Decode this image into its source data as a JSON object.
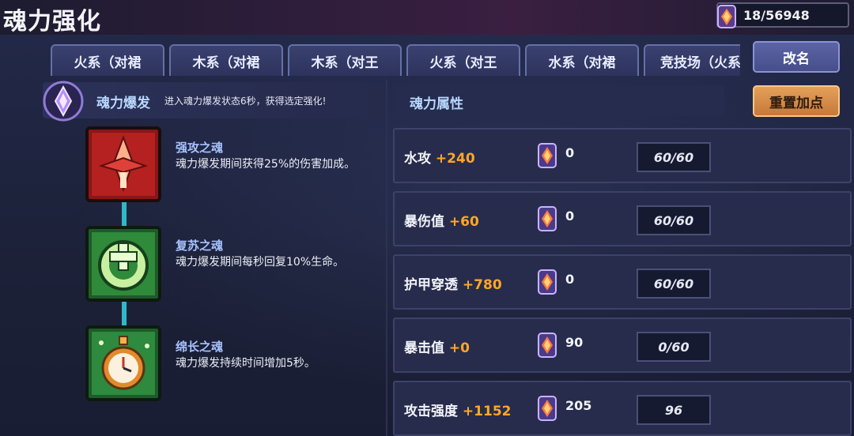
{
  "header": {
    "title": "魂力强化",
    "currency_value": "18/56948"
  },
  "tabs": [
    {
      "label": "火系（对裙"
    },
    {
      "label": "木系（对裙"
    },
    {
      "label": "木系（对王"
    },
    {
      "label": "火系（对王"
    },
    {
      "label": "水系（对裙"
    },
    {
      "label": "竞技场（火系"
    }
  ],
  "buttons": {
    "rename": "改名",
    "reset": "重置加点"
  },
  "soul_burst": {
    "title": "魂力爆发",
    "description": "进入魂力爆发状态6秒，获得选定强化!"
  },
  "buffs": [
    {
      "name": "强攻之魂",
      "description": "魂力爆发期间获得25%的伤害加成。",
      "icon": "red-sword-soul-icon"
    },
    {
      "name": "复苏之魂",
      "description": "魂力爆发期间每秒回复10%生命。",
      "icon": "green-heal-soul-icon"
    },
    {
      "name": "绵长之魂",
      "description": "魂力爆发持续时间增加5秒。",
      "icon": "stopwatch-soul-icon"
    }
  ],
  "attributes": {
    "title": "魂力属性",
    "rows": [
      {
        "name": "水攻",
        "bonus": "+240",
        "cost": "0",
        "level": "60/60"
      },
      {
        "name": "暴伤值",
        "bonus": "+60",
        "cost": "0",
        "level": "60/60"
      },
      {
        "name": "护甲穿透",
        "bonus": "+780",
        "cost": "0",
        "level": "60/60"
      },
      {
        "name": "暴击值",
        "bonus": "+0",
        "cost": "90",
        "level": "0/60"
      },
      {
        "name": "攻击强度",
        "bonus": "+1152",
        "cost": "205",
        "level": "96"
      }
    ]
  },
  "colors": {
    "accent_orange": "#ffa726",
    "label_blue": "#b9d8ff",
    "connector_cyan": "#30b8c8"
  }
}
